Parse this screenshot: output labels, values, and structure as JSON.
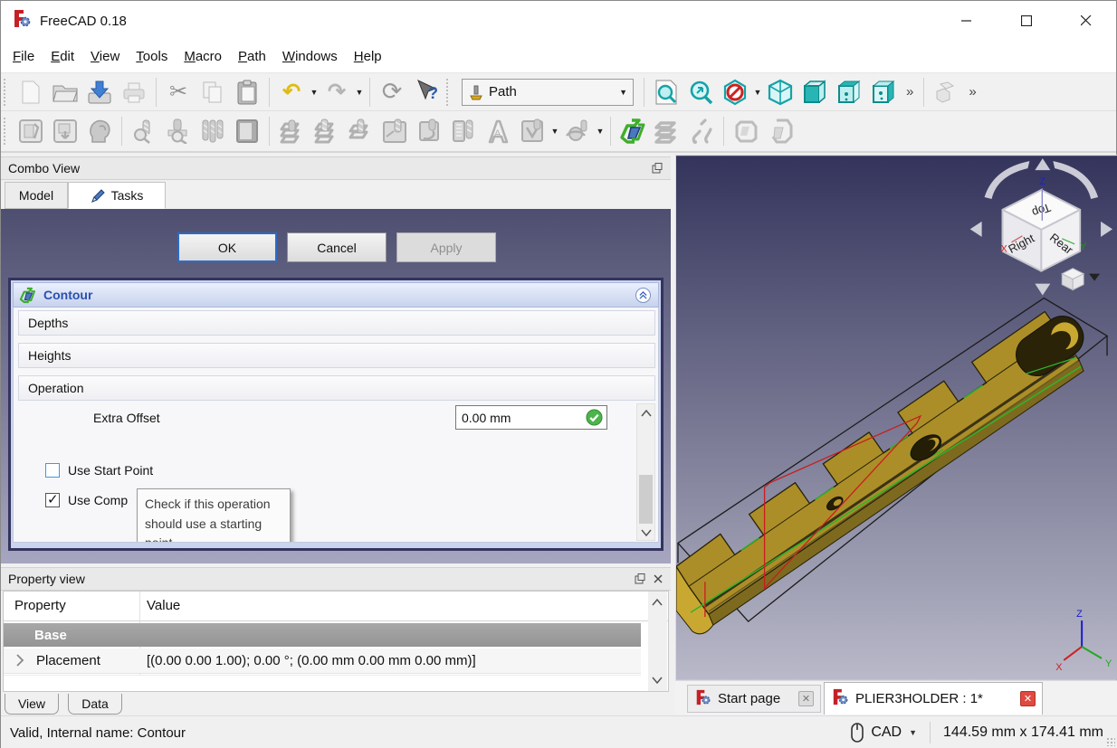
{
  "window": {
    "title": "FreeCAD 0.18"
  },
  "menu": {
    "items": [
      "File",
      "Edit",
      "View",
      "Tools",
      "Macro",
      "Path",
      "Windows",
      "Help"
    ]
  },
  "toolbars": {
    "workbench_selector": "Path",
    "overflow": "»"
  },
  "combo_view": {
    "title": "Combo View",
    "tab_model": "Model",
    "tab_tasks": "Tasks"
  },
  "tasks": {
    "ok": "OK",
    "cancel": "Cancel",
    "apply": "Apply",
    "section": "Contour",
    "group_depths": "Depths",
    "group_heights": "Heights",
    "group_operation": "Operation",
    "extra_offset_label": "Extra Offset",
    "extra_offset_value": "0.00 mm",
    "use_start_point": {
      "label": "Use Start Point",
      "checked": false
    },
    "use_compensation": {
      "label": "Use Comp",
      "checked": true
    },
    "tooltip": "Check if this operation should use a starting point."
  },
  "property_view": {
    "title": "Property view",
    "col_property": "Property",
    "col_value": "Value",
    "group_base": "Base",
    "rows": [
      {
        "property": "Placement",
        "value": "[(0.00 0.00 1.00); 0.00 °; (0.00 mm  0.00 mm  0.00 mm)]"
      }
    ],
    "tab_view": "View",
    "tab_data": "Data"
  },
  "viewport": {
    "nav_cube": {
      "top": "Top",
      "right": "Right",
      "rear": "Rear",
      "axis_z": "Z",
      "axis_y": "Y",
      "axis_x": "X"
    },
    "triad": {
      "z": "Z",
      "x": "X",
      "y": "Y"
    },
    "doc_tabs": [
      {
        "label": "Start page",
        "active": false
      },
      {
        "label": "PLIER3HOLDER : 1*",
        "active": true
      }
    ]
  },
  "statusbar": {
    "message": "Valid, Internal name: Contour",
    "nav_style": "CAD",
    "dimensions": "144.59 mm x 174.41 mm"
  },
  "colors": {
    "accent": "#0078d7",
    "contour_title": "#2a50b0",
    "part_gold": "#ac8e28",
    "toolpath_red": "#c81e1e",
    "edge_green": "#2db52d",
    "viewport_top": "#34345c",
    "viewport_bottom": "#b9b9c9"
  }
}
